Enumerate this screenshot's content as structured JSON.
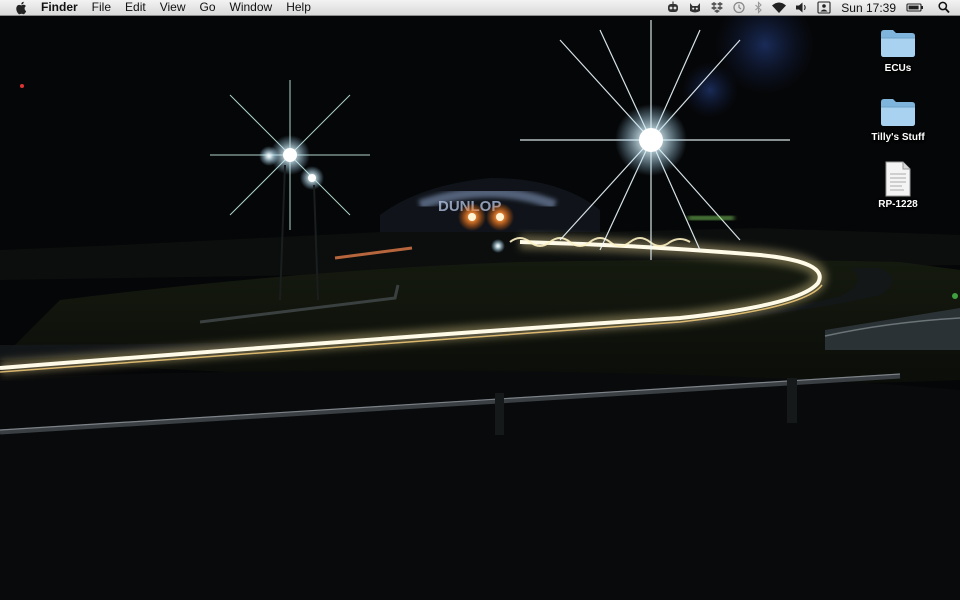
{
  "menubar": {
    "apple_icon": "apple-icon",
    "app_name": "Finder",
    "menus": [
      "File",
      "Edit",
      "View",
      "Go",
      "Window",
      "Help"
    ],
    "status_icons": [
      "robot-icon",
      "cat-icon",
      "dropbox-icon",
      "time-machine-icon",
      "bluetooth-icon",
      "wifi-icon",
      "volume-icon",
      "user-icon"
    ],
    "clock": "Sun 17:39",
    "battery_icon": "battery-icon",
    "spotlight_icon": "spotlight-search-icon"
  },
  "desktop": {
    "icons": [
      {
        "label": "ECUs",
        "type": "folder-icon"
      },
      {
        "label": "Tilly's Stuff",
        "type": "folder-icon"
      },
      {
        "label": "RP-1228",
        "type": "document-icon"
      }
    ]
  },
  "wallpaper": {
    "sign_text": "DUNLOP",
    "colors": {
      "sky": "#050607",
      "light_trail": "#fff6d0",
      "floodlight": "#eaf8ff",
      "brake_light": "#ff7a2a",
      "grass": "#1b2010"
    }
  }
}
